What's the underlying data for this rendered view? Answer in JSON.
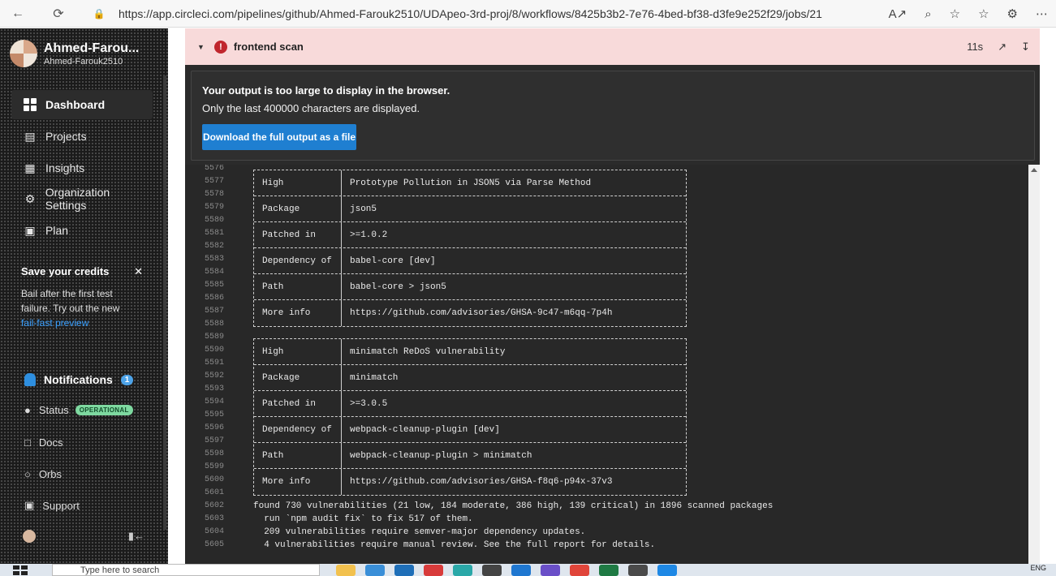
{
  "browser": {
    "url": "https://app.circleci.com/pipelines/github/Ahmed-Farouk2510/UDApeo-3rd-proj/8/workflows/8425b3b2-7e76-4bed-bf38-d3fe9e252f29/jobs/21"
  },
  "sidebar": {
    "user_name": "Ahmed-Farou...",
    "user_login": "Ahmed-Farouk2510",
    "items": [
      {
        "label": "Dashboard",
        "icon": "dashboard-icon"
      },
      {
        "label": "Projects",
        "icon": "projects-icon"
      },
      {
        "label": "Insights",
        "icon": "insights-icon"
      },
      {
        "label": "Organization Settings",
        "icon": "settings-icon"
      },
      {
        "label": "Plan",
        "icon": "plan-icon"
      }
    ],
    "promo": {
      "title": "Save your credits",
      "body": "Bail after the first test failure. Try out the new",
      "link": "fail-fast preview"
    },
    "notifications_label": "Notifications",
    "notifications_count": "1",
    "status_label": "Status",
    "status_badge": "OPERATIONAL",
    "docs_label": "Docs",
    "orbs_label": "Orbs",
    "support_label": "Support"
  },
  "job": {
    "name": "frontend scan",
    "duration": "11s"
  },
  "notice": {
    "title": "Your output is too large to display in the browser.",
    "subtitle": "Only the last 400000 characters are displayed.",
    "button": "Download the full output as a file"
  },
  "log": {
    "table1": [
      {
        "key": "High",
        "value": "Prototype Pollution in JSON5 via Parse Method"
      },
      {
        "key": "Package",
        "value": "json5"
      },
      {
        "key": "Patched in",
        "value": ">=1.0.2"
      },
      {
        "key": "Dependency of",
        "value": "babel-core [dev]"
      },
      {
        "key": "Path",
        "value": "babel-core > json5"
      },
      {
        "key": "More info",
        "value": "https://github.com/advisories/GHSA-9c47-m6qq-7p4h"
      }
    ],
    "table2": [
      {
        "key": "High",
        "value": "minimatch ReDoS vulnerability"
      },
      {
        "key": "Package",
        "value": "minimatch"
      },
      {
        "key": "Patched in",
        "value": ">=3.0.5"
      },
      {
        "key": "Dependency of",
        "value": "webpack-cleanup-plugin [dev]"
      },
      {
        "key": "Path",
        "value": "webpack-cleanup-plugin > minimatch"
      },
      {
        "key": "More info",
        "value": "https://github.com/advisories/GHSA-f8q6-p94x-37v3"
      }
    ],
    "line_numbers": [
      "5576",
      "5577",
      "5578",
      "5579",
      "5580",
      "5581",
      "5582",
      "5583",
      "5584",
      "5585",
      "5586",
      "5587",
      "5588",
      "5589",
      "5590",
      "5591",
      "5592",
      "5593",
      "5594",
      "5595",
      "5596",
      "5597",
      "5598",
      "5599",
      "5600",
      "5601",
      "5602",
      "5603",
      "5604",
      "5605"
    ],
    "summary": [
      "found 730 vulnerabilities (21 low, 184 moderate, 386 high, 139 critical) in 1896 scanned packages",
      "  run `npm audit fix` to fix 517 of them.",
      "  209 vulnerabilities require semver-major dependency updates.",
      "  4 vulnerabilities require manual review. See the full report for details."
    ]
  },
  "taskbar": {
    "search_placeholder": "Type here to search",
    "lang": "ENG"
  }
}
